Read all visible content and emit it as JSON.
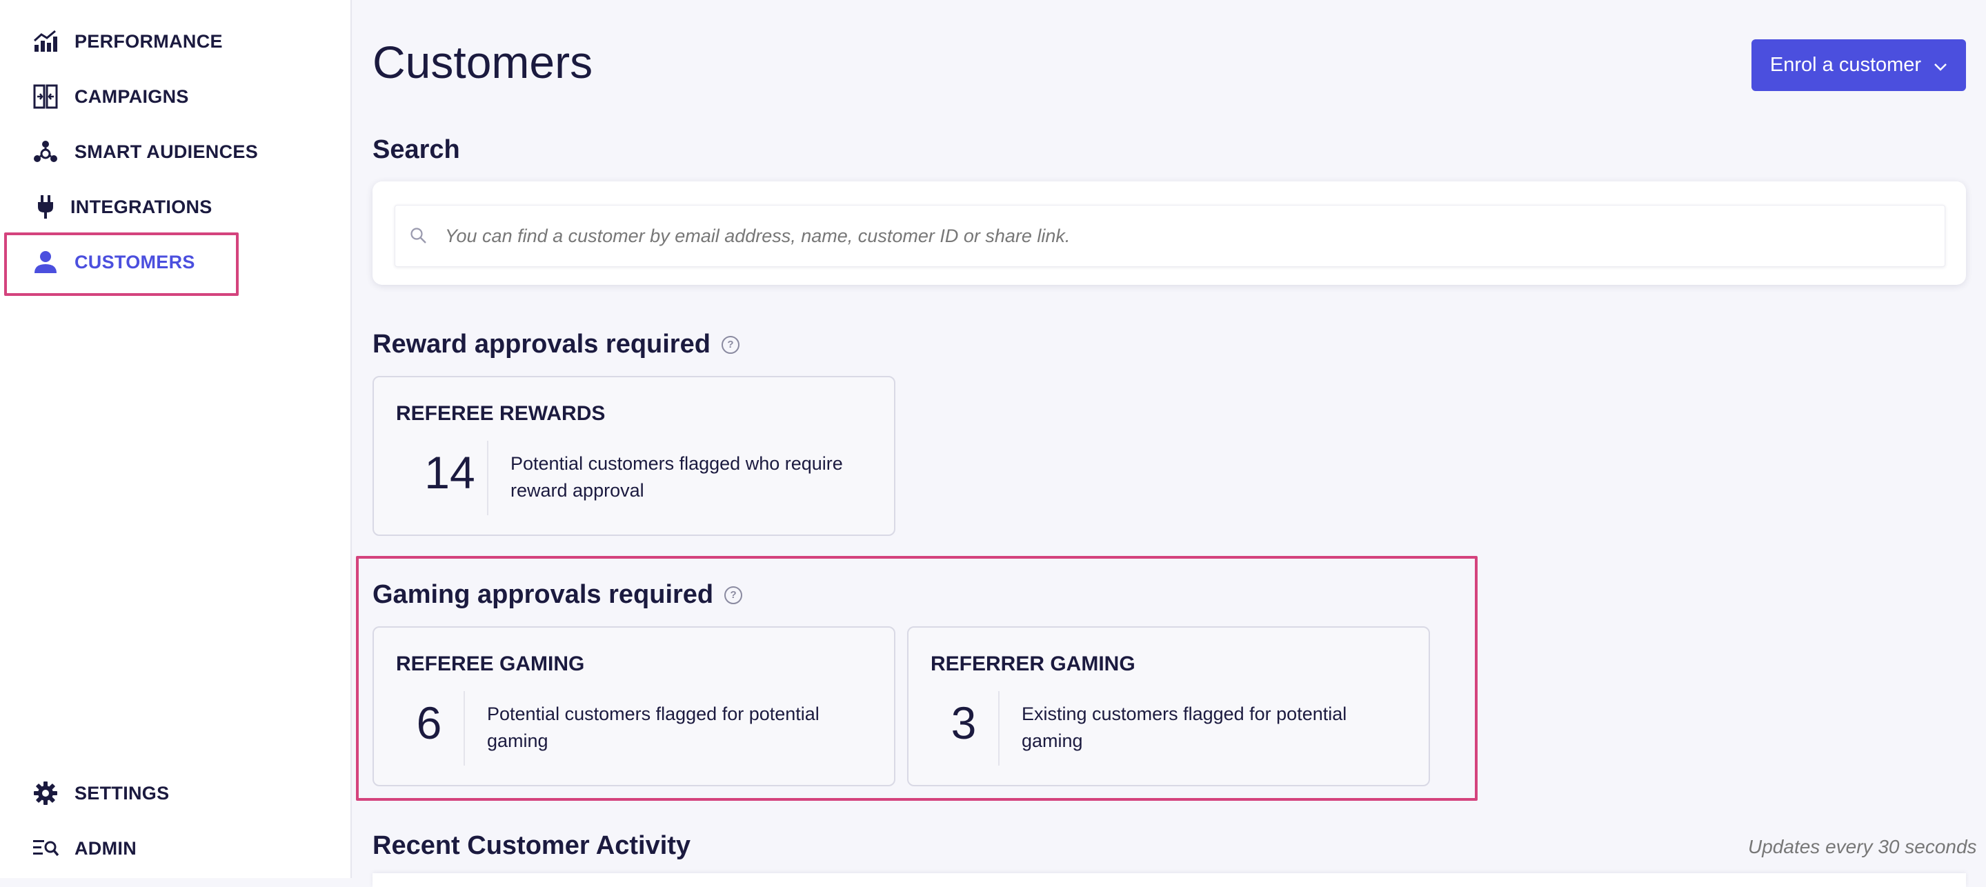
{
  "sidebar": {
    "items": [
      {
        "label": "PERFORMANCE",
        "icon": "performance-chart-icon"
      },
      {
        "label": "CAMPAIGNS",
        "icon": "campaigns-icon"
      },
      {
        "label": "SMART AUDIENCES",
        "icon": "smart-audiences-icon"
      },
      {
        "label": "INTEGRATIONS",
        "icon": "plug-icon"
      },
      {
        "label": "CUSTOMERS",
        "icon": "person-icon",
        "active": true
      }
    ],
    "bottom_items": [
      {
        "label": "SETTINGS",
        "icon": "gear-icon"
      },
      {
        "label": "ADMIN",
        "icon": "admin-search-icon"
      }
    ]
  },
  "header": {
    "title": "Customers",
    "enrol_button_label": "Enrol a customer"
  },
  "search": {
    "heading": "Search",
    "placeholder": "You can find a customer by email address, name, customer ID or share link."
  },
  "reward_approvals": {
    "heading": "Reward approvals required",
    "cards": [
      {
        "title": "REFEREE REWARDS",
        "count": "14",
        "description": "Potential customers flagged who require reward approval"
      }
    ]
  },
  "gaming_approvals": {
    "heading": "Gaming approvals required",
    "cards": [
      {
        "title": "REFEREE GAMING",
        "count": "6",
        "description": "Potential customers flagged for potential gaming"
      },
      {
        "title": "REFERRER GAMING",
        "count": "3",
        "description": "Existing customers flagged for potential gaming"
      }
    ]
  },
  "recent_activity": {
    "heading": "Recent Customer Activity",
    "updates_note": "Updates every 30 seconds"
  },
  "colors": {
    "accent": "#4b4fde",
    "highlight": "#d4437d",
    "text": "#1b1a3f"
  }
}
